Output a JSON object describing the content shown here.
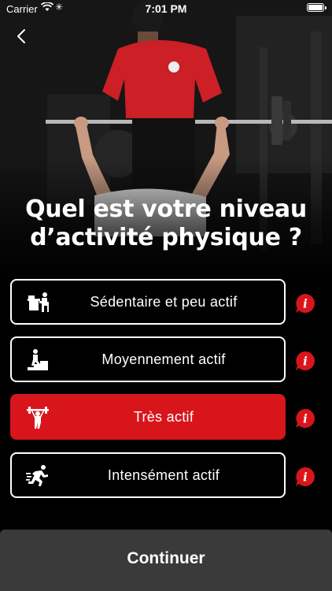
{
  "status_bar": {
    "carrier": "Carrier",
    "time": "7:01 PM"
  },
  "title": {
    "line1": "Quel est votre niveau",
    "line2": "d’activité physique ?"
  },
  "options": [
    {
      "label": "Sédentaire et peu actif",
      "icon": "desk-sitting-icon",
      "selected": false
    },
    {
      "label": "Moyennement actif",
      "icon": "stairs-walking-icon",
      "selected": false
    },
    {
      "label": "Très actif",
      "icon": "weightlifting-icon",
      "selected": true
    },
    {
      "label": "Intensément actif",
      "icon": "running-icon",
      "selected": false
    }
  ],
  "info_icon": {
    "glyph": "i",
    "color": "#d9151c"
  },
  "continue_label": "Continuer",
  "colors": {
    "accent": "#d9151c",
    "background": "#000000",
    "continue_bg": "#3a3a3a"
  }
}
